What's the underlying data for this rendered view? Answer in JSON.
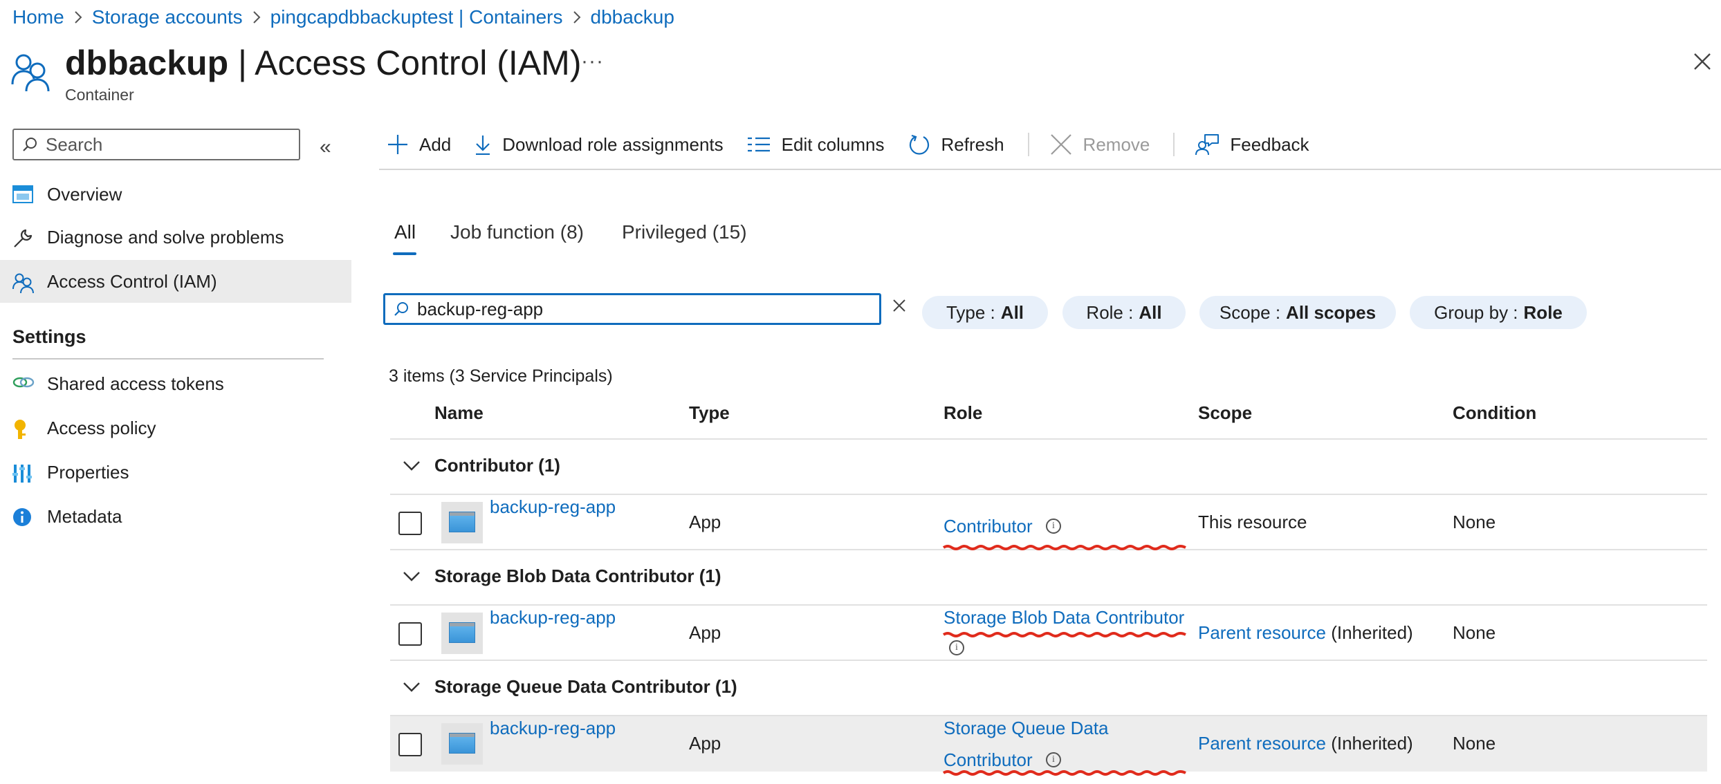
{
  "breadcrumb": [
    "Home",
    "Storage accounts",
    "pingcapdbbackuptest | Containers",
    "dbbackup"
  ],
  "header": {
    "title_bold": "dbbackup",
    "title_rest": " | Access Control (IAM)",
    "more": "···",
    "subtitle": "Container"
  },
  "sidebar": {
    "search_placeholder": "Search",
    "collapse": "«",
    "items": [
      {
        "label": "Overview",
        "icon": "overview-icon"
      },
      {
        "label": "Diagnose and solve problems",
        "icon": "wrench-icon"
      },
      {
        "label": "Access Control (IAM)",
        "icon": "people-icon"
      }
    ],
    "settings_header": "Settings",
    "settings_items": [
      {
        "label": "Shared access tokens",
        "icon": "link-icon"
      },
      {
        "label": "Access policy",
        "icon": "key-icon"
      },
      {
        "label": "Properties",
        "icon": "properties-icon"
      },
      {
        "label": "Metadata",
        "icon": "info-icon"
      }
    ]
  },
  "toolbar": {
    "add": "Add",
    "download": "Download role assignments",
    "edit_columns": "Edit columns",
    "refresh": "Refresh",
    "remove": "Remove",
    "feedback": "Feedback"
  },
  "tabs": [
    "All",
    "Job function (8)",
    "Privileged (15)"
  ],
  "filter": {
    "value": "backup-reg-app",
    "pills": [
      {
        "key": "Type :",
        "value": "All"
      },
      {
        "key": "Role :",
        "value": "All"
      },
      {
        "key": "Scope :",
        "value": "All scopes"
      },
      {
        "key": "Group by :",
        "value": "Role"
      }
    ]
  },
  "count": "3 items (3 Service Principals)",
  "table": {
    "headers": [
      "Name",
      "Type",
      "Role",
      "Scope",
      "Condition"
    ],
    "groups": [
      {
        "label": "Contributor (1)",
        "row": {
          "name": "backup-reg-app",
          "type": "App",
          "role": "Contributor",
          "scope_link": "",
          "scope_text": "This resource",
          "condition": "None"
        }
      },
      {
        "label": "Storage Blob Data Contributor (1)",
        "row": {
          "name": "backup-reg-app",
          "type": "App",
          "role": "Storage Blob Data Contributor",
          "scope_link": "Parent resource",
          "scope_text": "(Inherited)",
          "condition": "None"
        }
      },
      {
        "label": "Storage Queue Data Contributor (1)",
        "row": {
          "name": "backup-reg-app",
          "type": "App",
          "role_line1": "Storage Queue Data",
          "role_line2": "Contributor",
          "scope_link": "Parent resource",
          "scope_text": "(Inherited)",
          "condition": "None"
        }
      }
    ]
  },
  "colors": {
    "accent": "#0f6cbd",
    "annotation": "#e02b1c",
    "pill_bg": "#e8f0fa"
  }
}
